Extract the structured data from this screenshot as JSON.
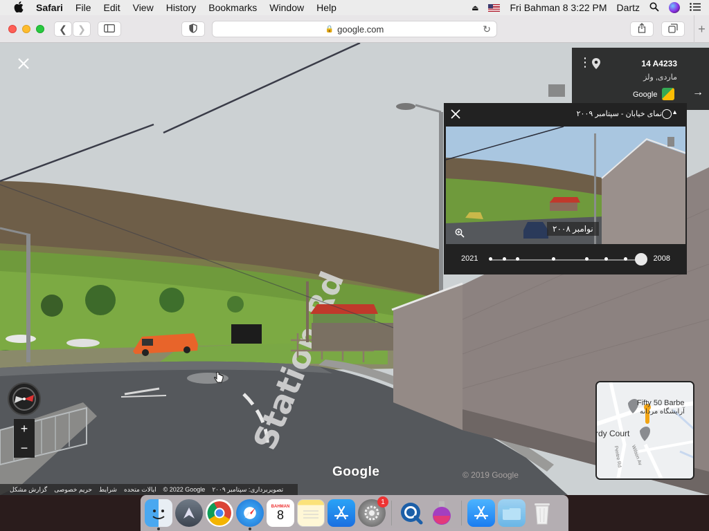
{
  "menubar": {
    "app": "Safari",
    "items": [
      "File",
      "Edit",
      "View",
      "History",
      "Bookmarks",
      "Window",
      "Help"
    ],
    "datetime": "Fri Bahman 8  3:22 PM",
    "user": "Dartz"
  },
  "toolbar": {
    "url": "google.com"
  },
  "address_card": {
    "line1": "14 A4233",
    "line2": "ماردی, ولز",
    "brand": "Google"
  },
  "time_travel": {
    "title": "نمای خیابان - سپتامبر ۲۰۰۹",
    "badge_date": "نوامبر ۲۰۰۸",
    "year_start": "2021",
    "year_end": "2008"
  },
  "street_sign": "Station Rd",
  "watermark": "Google",
  "faded_watermark": "© 2019 Google",
  "minimap": {
    "label1": "Fifty 50 Barbe",
    "label2": "آرایشگاه مردانه",
    "label3": "rdy Court",
    "road1": "Pentre Rd",
    "road2": "Wilson Av"
  },
  "attribution": [
    "گزارش مشکل",
    "حریم خصوصی",
    "شرایط",
    "ایالات متحده",
    "© 2022 Google",
    "تصویربرداری: سپتامبر ۲۰۰۹"
  ],
  "dock": {
    "calendar_month": "BAHMAN",
    "calendar_day": "8",
    "settings_badge": "1"
  },
  "colors": {
    "menubar_bg": "#ececec",
    "panel_bg": "#222222",
    "van": "#e8642a",
    "shed_roof": "#c0392b",
    "grass": "#6f9a3c",
    "hill": "#6b5a44"
  }
}
